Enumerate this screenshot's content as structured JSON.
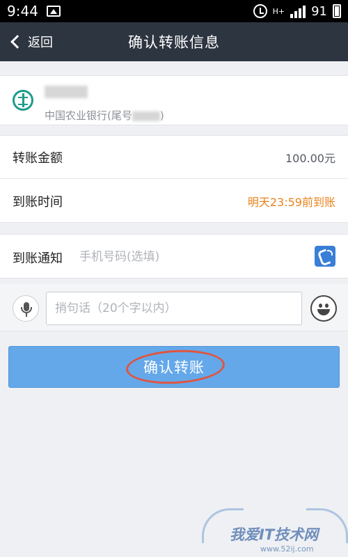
{
  "status_bar": {
    "time": "9:44",
    "network": "H+",
    "battery": "91"
  },
  "nav": {
    "back_label": "返回",
    "title": "确认转账信息"
  },
  "recipient": {
    "bank_name": "中国农业银行(尾号",
    "bank_name_suffix": ")"
  },
  "transfer": {
    "amount_label": "转账金额",
    "amount_value": "100.00元",
    "arrival_label": "到账时间",
    "arrival_value": "明天23:59前到账"
  },
  "notify": {
    "label": "到账通知",
    "phone_placeholder": "手机号码(选填)",
    "phone_value": ""
  },
  "message": {
    "placeholder": "捎句话（20个字以内）",
    "value": ""
  },
  "confirm_button_label": "确认转账",
  "watermark": {
    "text": "我爱IT技术网",
    "url": "www.52ij.com"
  },
  "colors": {
    "nav_bg": "#2d3541",
    "confirm_bg": "#64a8ea",
    "arrival_accent": "#e8821e",
    "bank_green": "#1d9b8a",
    "annotation_ring": "#e0553f"
  }
}
